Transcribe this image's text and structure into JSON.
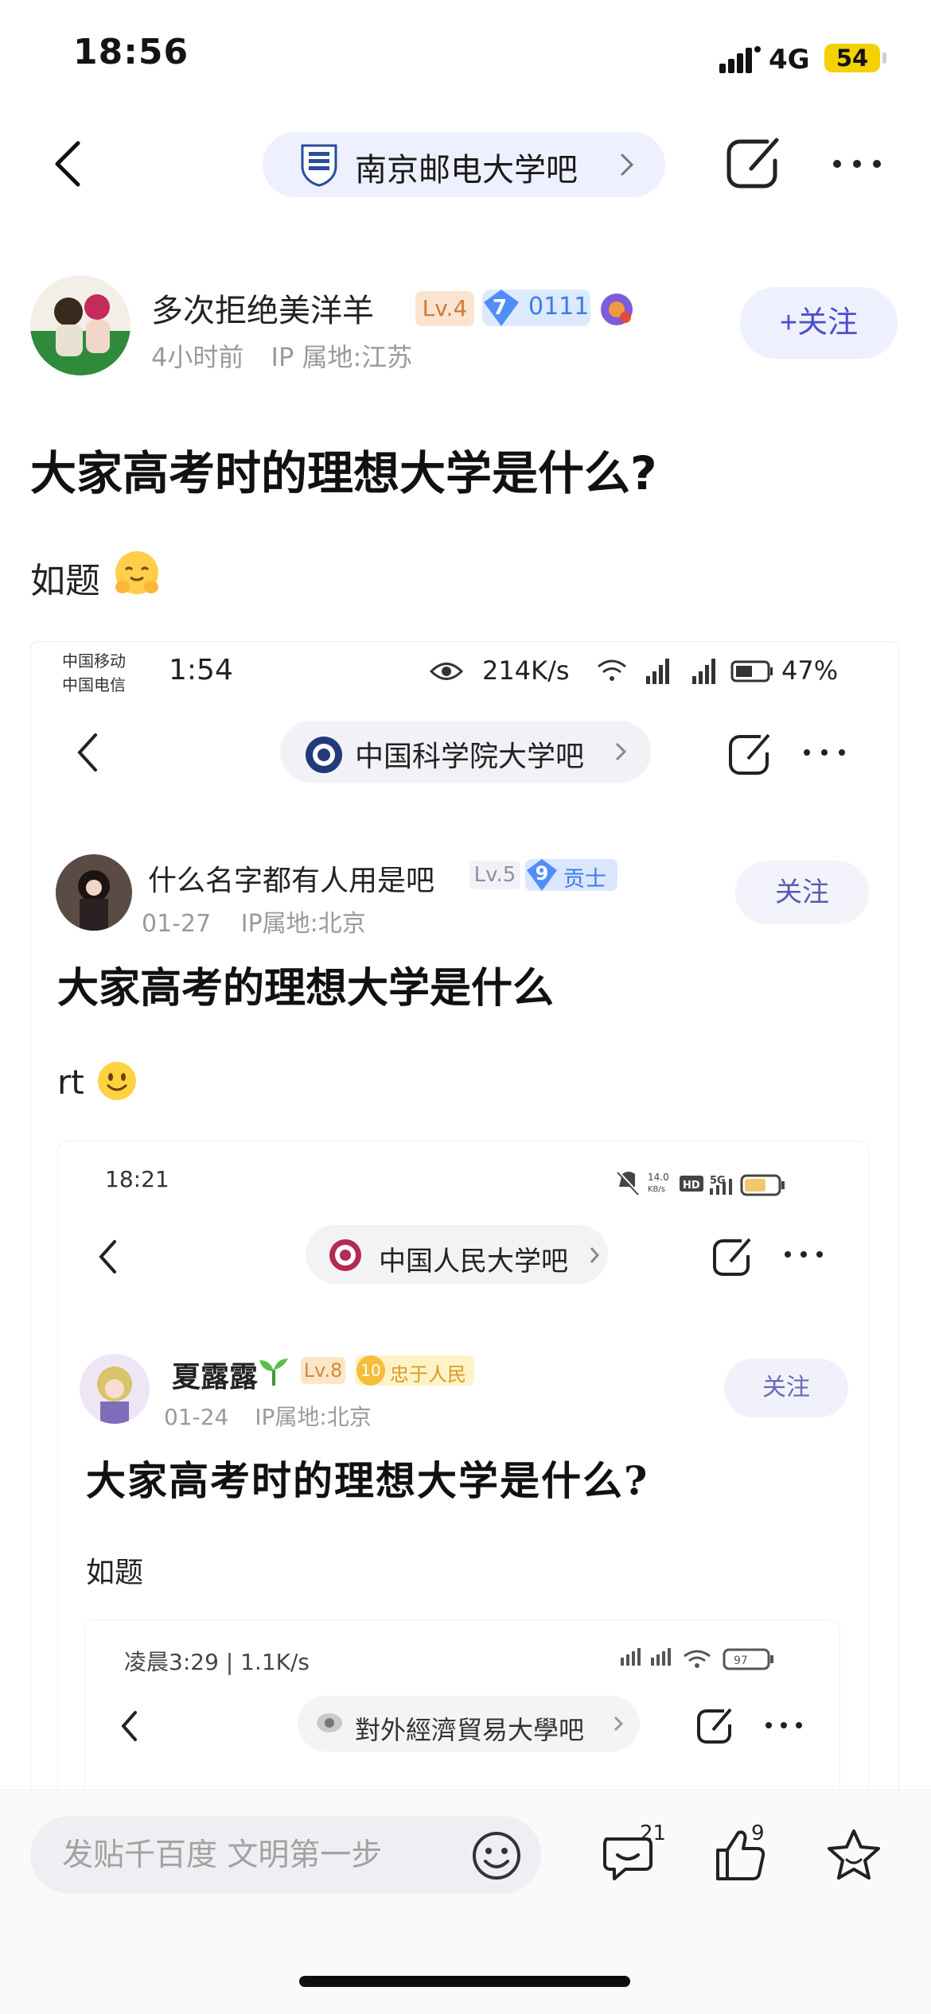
{
  "status_bar": {
    "time": "18:56",
    "network": "4G",
    "battery": "54"
  },
  "nav": {
    "forum_name": "南京邮电大学吧",
    "icons": [
      "back-icon",
      "forum-logo-icon",
      "chevron-right-icon",
      "share-icon",
      "more-icon"
    ]
  },
  "author": {
    "name": "多次拒绝美洋羊",
    "level": "Lv.4",
    "fan_level": "7",
    "fan_badge": "0111",
    "time": "4小时前",
    "ip_location": "IP 属地:江苏",
    "follow_label": "+关注"
  },
  "post": {
    "title": "大家高考时的理想大学是什么?",
    "body": "如题"
  },
  "quoted_1": {
    "carrier_top": "中国移动",
    "carrier_bottom": "中国电信",
    "time": "1:54",
    "speed": "214K/s",
    "battery_pct": "47%",
    "forum_name": "中国科学院大学吧",
    "author_name": "什么名字都有人用是吧",
    "level": "Lv.5",
    "fan_level": "9",
    "fan_title": "贡士",
    "date": "01-27",
    "ip_location": "IP属地:北京",
    "follow_label": "关注",
    "title": "大家高考的理想大学是什么",
    "body": "rt"
  },
  "quoted_2": {
    "time": "18:21",
    "forum_name": "中国人民大学吧",
    "author_name": "夏露露",
    "level": "Lv.8",
    "fan_level": "10",
    "fan_title": "忠于人民",
    "date": "01-24",
    "ip_location": "IP属地:北京",
    "follow_label": "关注",
    "title": "大家高考时的理想大学是什么?",
    "body": "如题"
  },
  "quoted_3": {
    "status": "凌晨3:29 | 1.1K/s",
    "battery": "97",
    "forum_name": "對外經濟貿易大學吧"
  },
  "bottom_bar": {
    "input_placeholder": "发贴千百度 文明第一步",
    "comment_count": "21",
    "like_count": "9"
  },
  "colors": {
    "accent": "#4b4fcc",
    "pill_bg": "#eef0ff",
    "battery": "#f4d100",
    "level_badge": "#fbe4cf"
  }
}
